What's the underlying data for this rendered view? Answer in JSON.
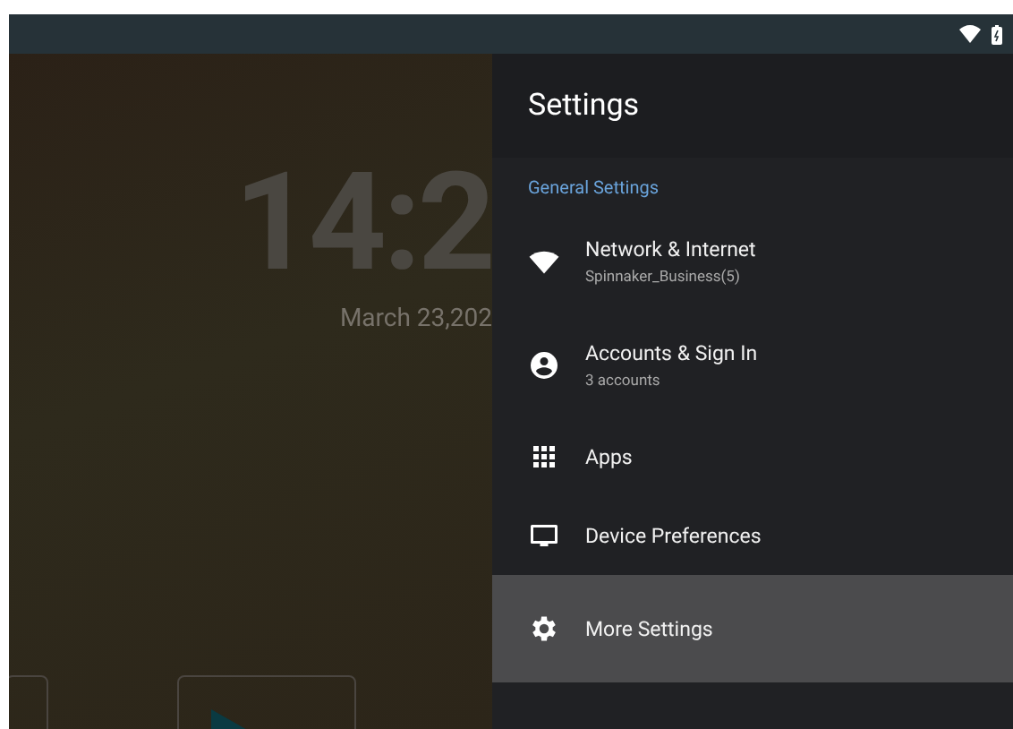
{
  "home": {
    "clock": "14:2",
    "date": "March 23,202"
  },
  "settings": {
    "title": "Settings",
    "section": "General Settings",
    "items": [
      {
        "label": "Network & Internet",
        "subtitle": "Spinnaker_Business(5)",
        "selected": false
      },
      {
        "label": "Accounts & Sign In",
        "subtitle": "3 accounts",
        "selected": false
      },
      {
        "label": "Apps",
        "selected": false
      },
      {
        "label": "Device Preferences",
        "selected": false
      },
      {
        "label": "More Settings",
        "selected": true
      }
    ]
  }
}
